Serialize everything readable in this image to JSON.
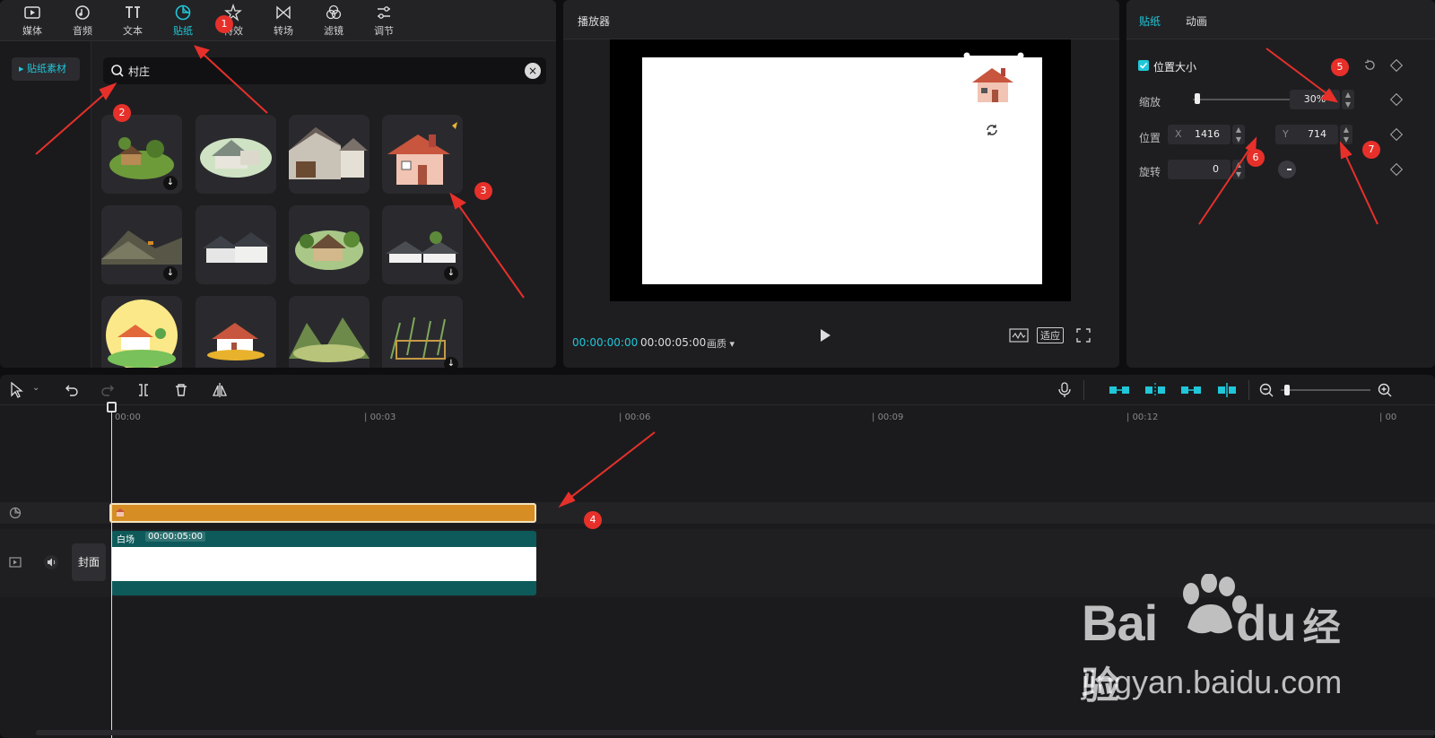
{
  "left_panel": {
    "tabs": [
      {
        "label": "媒体",
        "icon": "media-icon"
      },
      {
        "label": "音频",
        "icon": "audio-icon"
      },
      {
        "label": "文本",
        "icon": "text-icon"
      },
      {
        "label": "贴纸",
        "icon": "sticker-icon",
        "active": true
      },
      {
        "label": "特效",
        "icon": "effects-icon"
      },
      {
        "label": "转场",
        "icon": "transition-icon"
      },
      {
        "label": "滤镜",
        "icon": "filter-icon"
      },
      {
        "label": "调节",
        "icon": "adjust-icon"
      }
    ],
    "sidebar_item": "▸ 贴纸素材",
    "search_value": "村庄",
    "accent_color": "#20c7d8"
  },
  "player": {
    "title": "播放器",
    "current_time": "00:00:00:00",
    "total_time": "00:00:05:00",
    "quality": "画质",
    "fit_label": "适应"
  },
  "properties": {
    "tabs": [
      "贴纸",
      "动画"
    ],
    "section_title": "位置大小",
    "scale_label": "缩放",
    "scale_value": "30%",
    "scale_slider_level": 0.02,
    "position_label": "位置",
    "x_label": "X",
    "x_value": "1416",
    "y_label": "Y",
    "y_value": "714",
    "rotate_label": "旋转",
    "rotate_value": "0"
  },
  "timeline": {
    "ruler": [
      "00:00",
      "00:03",
      "00:06",
      "00:09",
      "00:12",
      "00"
    ],
    "clip_name": "白场",
    "clip_duration": "00:00:05:00",
    "cover_label": "封面",
    "sticker_clip_color": "#d68d24"
  },
  "annotations": [
    "1",
    "2",
    "3",
    "4",
    "5",
    "6",
    "7"
  ],
  "watermark": {
    "brand_latin": "Bai",
    "brand_du": "du",
    "brand_cn": "经验",
    "url": "jingyan.baidu.com"
  }
}
